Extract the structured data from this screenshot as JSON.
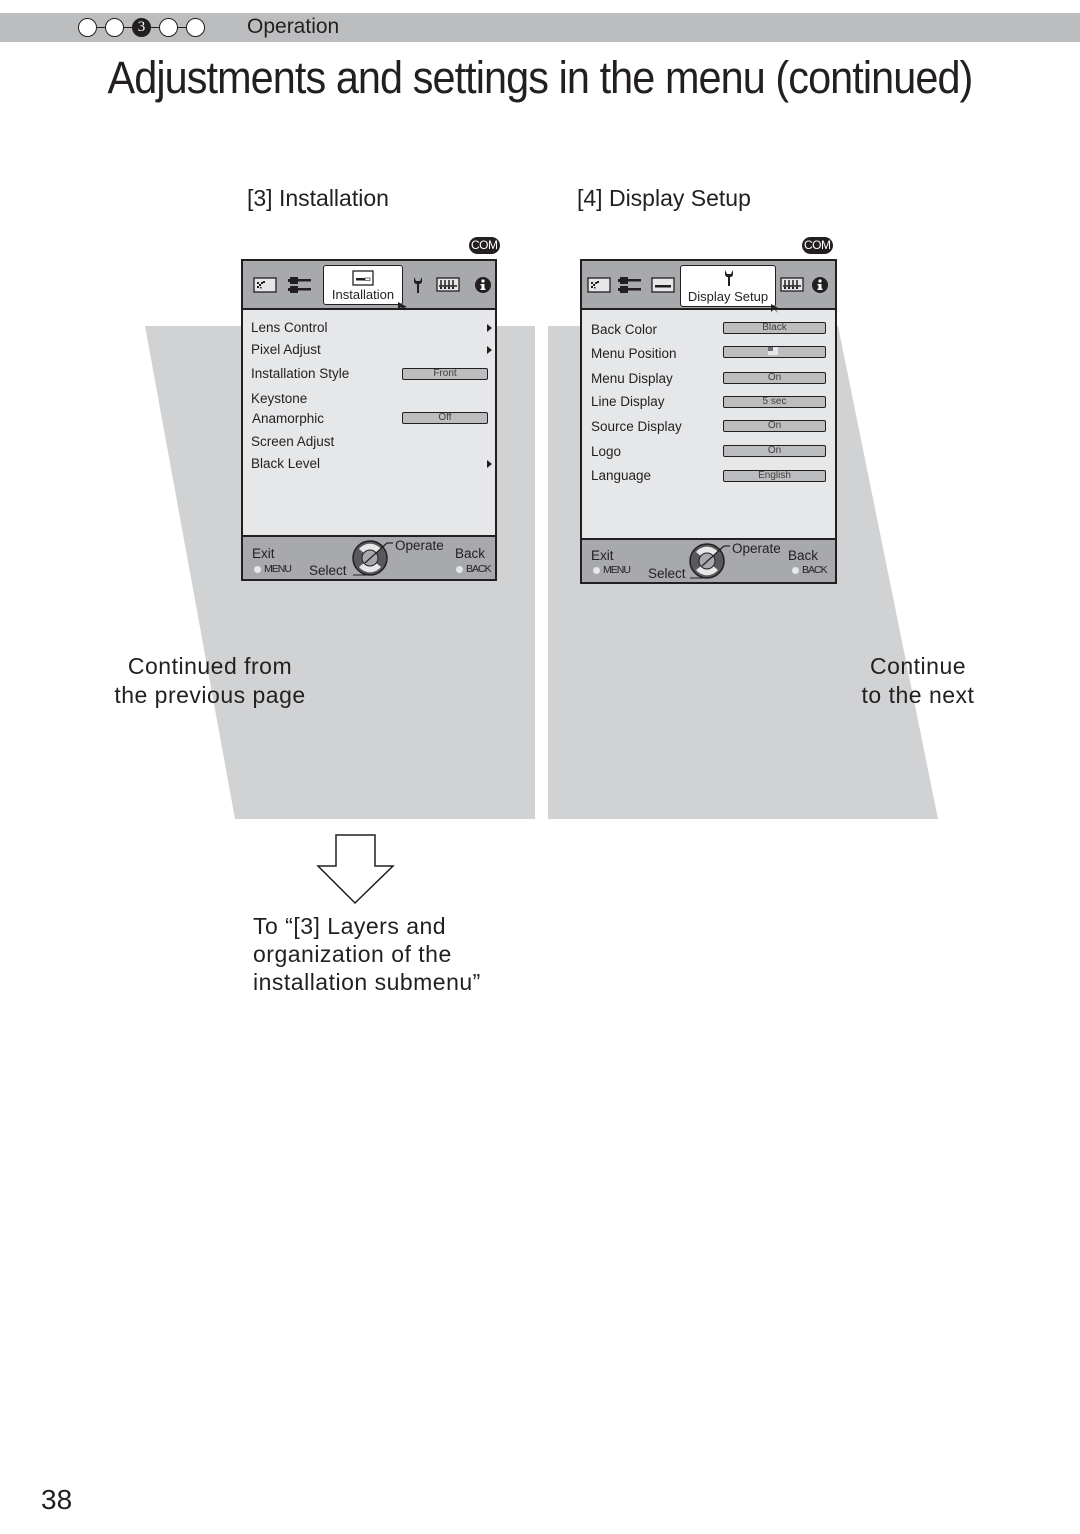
{
  "header": {
    "steps": [
      "",
      "",
      "3",
      "",
      ""
    ],
    "active_step": 3,
    "section": "Operation"
  },
  "page_title": "Adjustments and settings in the menu (continued)",
  "menus": [
    {
      "heading": "[3] Installation",
      "badge": "COM",
      "tabs": [
        "picture-adjust-icon",
        "input-signal-icon",
        "installation-icon",
        "display-setup-icon",
        "function-icon",
        "information-icon"
      ],
      "active_tab_label": "Installation",
      "items": [
        {
          "label": "Lens Control",
          "value": null,
          "submenu": true
        },
        {
          "label": "Pixel Adjust",
          "value": null,
          "submenu": true
        },
        {
          "label": "Installation Style",
          "value": "Front",
          "submenu": false
        },
        {
          "label": "Keystone",
          "value": null,
          "submenu": false
        },
        {
          "label": "Anamorphic",
          "value": "Off",
          "submenu": false
        },
        {
          "label": "Screen Adjust",
          "value": null,
          "submenu": false
        },
        {
          "label": "Black Level",
          "value": null,
          "submenu": true
        }
      ],
      "footer": {
        "exit": "Exit",
        "menu_key": "MENU",
        "select": "Select",
        "operate": "Operate",
        "back": "Back",
        "back_key": "BACK"
      }
    },
    {
      "heading": "[4] Display Setup",
      "badge": "COM",
      "tabs": [
        "picture-adjust-icon",
        "input-signal-icon",
        "installation-icon",
        "display-setup-icon",
        "function-icon",
        "information-icon"
      ],
      "active_tab_label": "Display Setup",
      "items": [
        {
          "label": "Back Color",
          "value": "Black"
        },
        {
          "label": "Menu Position",
          "value": ""
        },
        {
          "label": "Menu Display",
          "value": "On"
        },
        {
          "label": "Line Display",
          "value": "5 sec"
        },
        {
          "label": "Source Display",
          "value": "On"
        },
        {
          "label": "Logo",
          "value": "On"
        },
        {
          "label": "Language",
          "value": "English"
        }
      ],
      "footer": {
        "exit": "Exit",
        "menu_key": "MENU",
        "select": "Select",
        "operate": "Operate",
        "back": "Back",
        "back_key": "BACK"
      }
    }
  ],
  "captions": {
    "prev_line1": "Continued from",
    "prev_line2": "the previous page",
    "next_line1": "Continue",
    "next_line2": "to the next"
  },
  "note": {
    "line1": "To “[3] Layers and",
    "line2": "organization of the",
    "line3": "installation submenu”"
  },
  "page_number": "38"
}
